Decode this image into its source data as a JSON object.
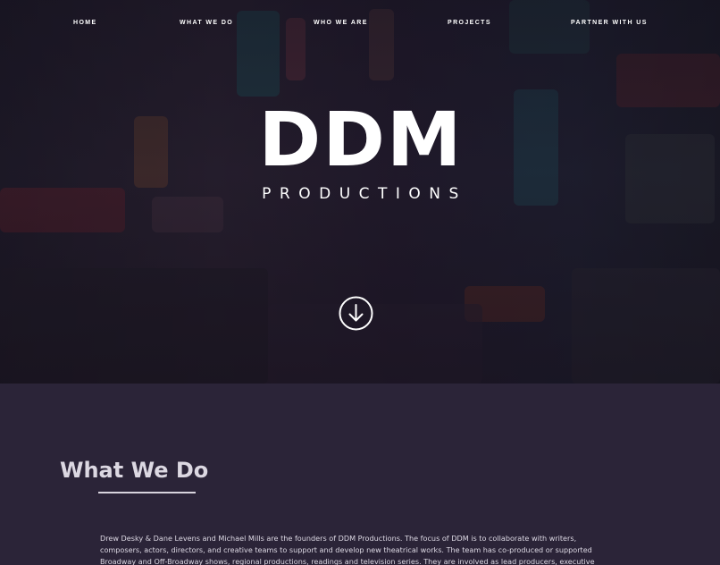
{
  "nav": {
    "items": [
      {
        "label": "HOME"
      },
      {
        "label": "WHAT WE DO"
      },
      {
        "label": "WHO WE ARE"
      },
      {
        "label": "PROJECTS"
      },
      {
        "label": "PARTNER WITH US"
      }
    ]
  },
  "hero": {
    "logo_main": "DDM",
    "logo_sub": "PRODUCTIONS",
    "scroll_icon": "arrow-down-circle-icon"
  },
  "about": {
    "title": "What We Do",
    "body": "Drew Desky & Dane Levens and Michael Mills are the founders of DDM Productions. The focus of DDM is to collaborate with writers, composers, actors, directors, and creative teams to support and develop new theatrical works. The team has co-produced or supported Broadway and Off-Broadway shows, regional productions, readings and television series. They are involved as lead producers, executive"
  },
  "colors": {
    "hero_overlay": "#1c1826",
    "section_bg": "#2b2438",
    "text_light": "#ffffff",
    "body_text": "#ddd9e4"
  }
}
